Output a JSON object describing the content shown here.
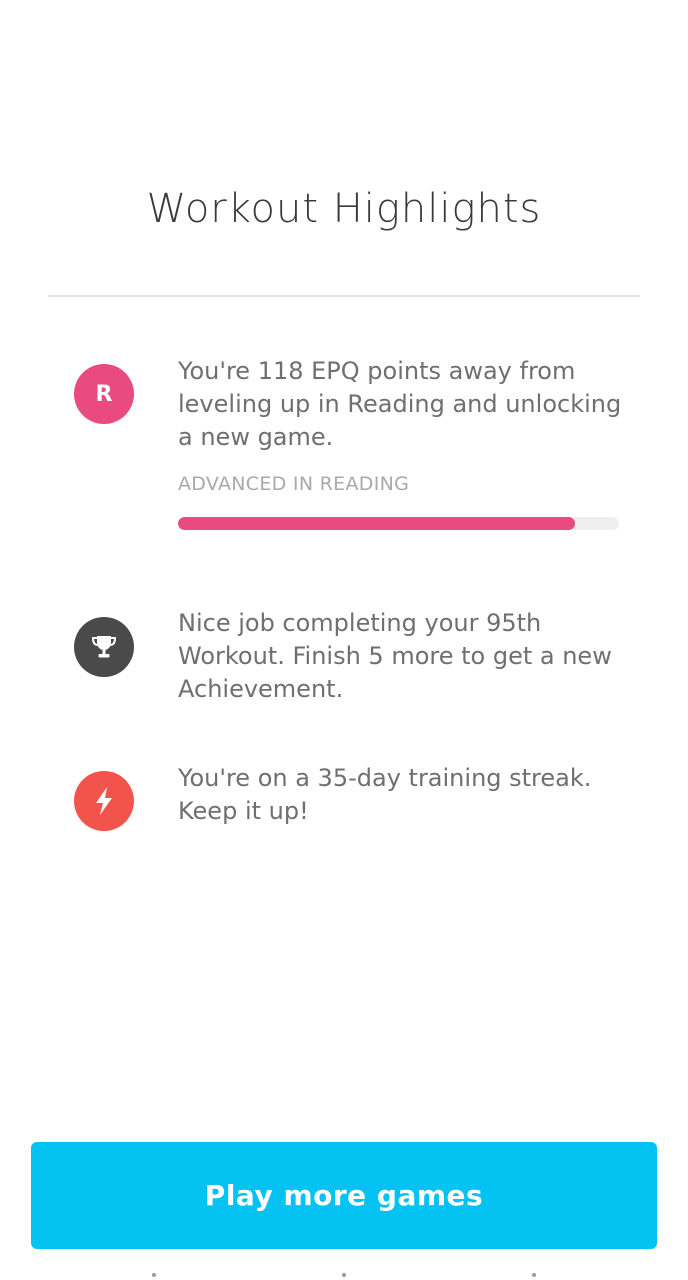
{
  "header": {
    "title": "Workout Highlights"
  },
  "highlights": [
    {
      "icon": "reading-letter-icon",
      "icon_text": "R",
      "icon_color": "#e94a80",
      "text": "You're 118 EPQ points away from leveling up in Reading and unlocking a new game.",
      "level_label": "ADVANCED IN READING",
      "progress_fraction": 0.9
    },
    {
      "icon": "trophy-icon",
      "icon_color": "#4a4a4a",
      "text": "Nice job completing your 95th Workout. Finish 5 more to get a new Achievement."
    },
    {
      "icon": "lightning-bolt-icon",
      "icon_color": "#f2534b",
      "text": "You're on a 35-day training streak. Keep it up!"
    }
  ],
  "cta": {
    "label": "Play more games",
    "color": "#04c3f2"
  },
  "colors": {
    "progress_fill": "#e94a80",
    "progress_track": "#efefef"
  }
}
